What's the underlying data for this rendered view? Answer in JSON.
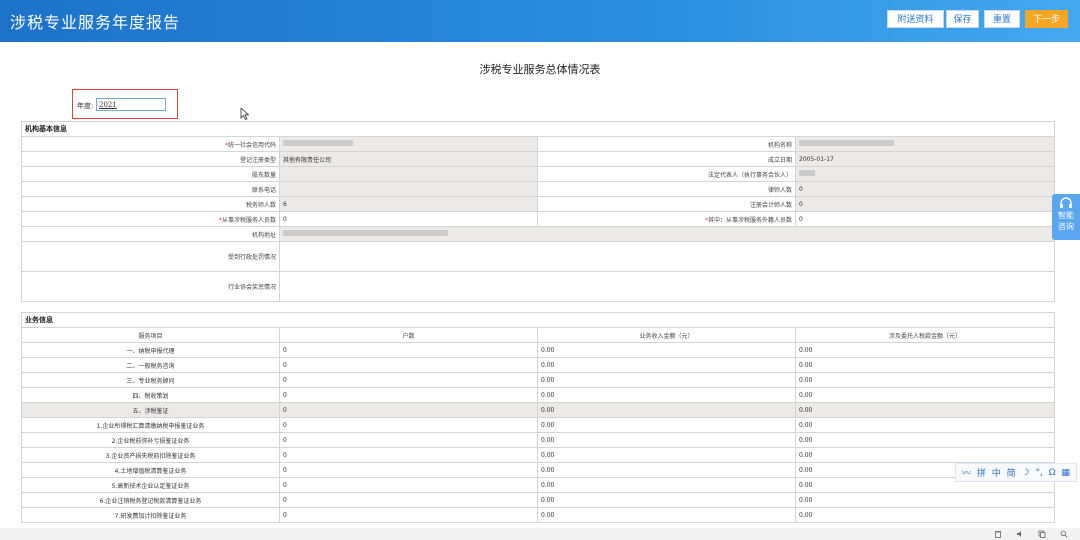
{
  "header": {
    "app_title": "涉税专业服务年度报告",
    "buttons": {
      "attach": "附送资料",
      "save": "保存",
      "reset": "重置",
      "next": "下一步"
    }
  },
  "form_title": "涉税专业服务总体情况表",
  "year": {
    "label": "年度:",
    "value": "2021"
  },
  "org": {
    "section_title": "机构基本信息",
    "rows": [
      {
        "l1": "统一社会信用代码",
        "req1": true,
        "v1": "",
        "l2": "机构名称",
        "req2": false,
        "v2": ""
      },
      {
        "l1": "登记注册类型",
        "req1": false,
        "v1": "其他有限责任公司",
        "l2": "成立日期",
        "req2": false,
        "v2": "2005-01-17"
      },
      {
        "l1": "股东数量",
        "req1": false,
        "v1": "",
        "l2": "法定代表人（执行事务合伙人）",
        "req2": false,
        "v2": ""
      },
      {
        "l1": "联系电话",
        "req1": false,
        "v1": "",
        "l2": "律师人数",
        "req2": false,
        "v2": "0"
      },
      {
        "l1": "税务师人数",
        "req1": false,
        "v1": "6",
        "l2": "注册会计师人数",
        "req2": false,
        "v2": "0"
      },
      {
        "l1": "从事涉税服务人员数",
        "req1": true,
        "v1": "0",
        "l2": "其中：从事涉税服务外籍人员数",
        "req2": true,
        "v2": "0"
      }
    ],
    "address_label": "机构地址",
    "penalty_label": "受到行政处罚情况",
    "award_label": "行业协会奖惩情况"
  },
  "business": {
    "section_title": "业务信息",
    "headers": [
      "服务项目",
      "户数",
      "业务收入金额（元）",
      "涉及委托人税款金额（元）"
    ],
    "rows": [
      {
        "name": "一、纳税申报代理",
        "count": "0",
        "income": "0.00",
        "tax": "0.00"
      },
      {
        "name": "二、一般税务咨询",
        "count": "0",
        "income": "0.00",
        "tax": "0.00"
      },
      {
        "name": "三、专业税务顾问",
        "count": "0",
        "income": "0.00",
        "tax": "0.00"
      },
      {
        "name": "四、税收策划",
        "count": "0",
        "income": "0.00",
        "tax": "0.00"
      },
      {
        "name": "五、涉税鉴证",
        "count": "0",
        "income": "0.00",
        "tax": "0.00"
      },
      {
        "name": "1.企业所得税汇算清缴纳税申报鉴证业务",
        "count": "0",
        "income": "0.00",
        "tax": "0.00"
      },
      {
        "name": "2.企业税前弥补亏损鉴证业务",
        "count": "0",
        "income": "0.00",
        "tax": "0.00"
      },
      {
        "name": "3.企业资产损失税前扣除鉴证业务",
        "count": "0",
        "income": "0.00",
        "tax": "0.00"
      },
      {
        "name": "4.土地增值税清算鉴证业务",
        "count": "0",
        "income": "0.00",
        "tax": "0.00"
      },
      {
        "name": "5.高新技术企业认定鉴证业务",
        "count": "0",
        "income": "0.00",
        "tax": "0.00"
      },
      {
        "name": "6.企业注销税务登记税款清算鉴证业务",
        "count": "0",
        "income": "0.00",
        "tax": "0.00"
      },
      {
        "name": "7.研发费加计扣除鉴证业务",
        "count": "0",
        "income": "0.00",
        "tax": "0.00"
      }
    ]
  },
  "side_widget": {
    "line1": "智能",
    "line2": "咨询"
  },
  "ime": {
    "items": [
      "拼",
      "中",
      "简"
    ]
  },
  "colors": {
    "header_blue": "#2a8ee0",
    "next_orange": "#f5a623",
    "required_red": "#e33333",
    "highlight_box": "#e0473c"
  }
}
